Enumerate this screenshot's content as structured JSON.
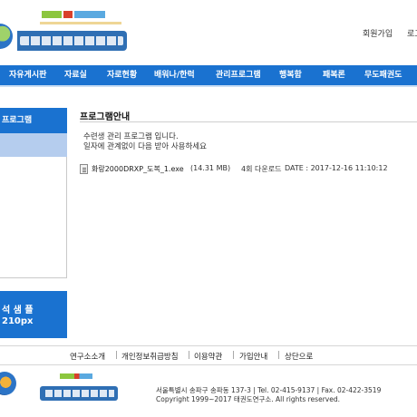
{
  "header": {
    "top_links": {
      "join": "회원가입",
      "login": "로그"
    },
    "colors": {
      "brand_blue": "#1a72d0",
      "highlight": "#b5cdee"
    }
  },
  "nav": {
    "items": [
      {
        "label": "자유게시판"
      },
      {
        "label": "자료실"
      },
      {
        "label": "자로현황"
      },
      {
        "label": "배워나/한럭"
      },
      {
        "label": "관리프로그램"
      },
      {
        "label": "행복함"
      },
      {
        "label": "패복론"
      },
      {
        "label": "무도패권도"
      }
    ]
  },
  "sidebar": {
    "title": "프로그램",
    "banner": {
      "line1": "석 샘 플",
      "line2": "210px"
    }
  },
  "content": {
    "title": "프로그램안내",
    "description": [
      "수련생 관리 프로그램 입니다.",
      "일자에 관계없이 다음 받아 사용하세요"
    ],
    "file": {
      "name": "화랑2000DRXP_도복_1.exe",
      "size": "(14.31 MB)",
      "downloads": "4회 다운로드",
      "date": "DATE : 2017-12-16 11:10:12"
    }
  },
  "footer": {
    "links": [
      {
        "label": "연구소소개"
      },
      {
        "label": "개인정보취급방침"
      },
      {
        "label": "이용약관"
      },
      {
        "label": "가입안내"
      },
      {
        "label": "상단으로"
      }
    ],
    "address": "서울특별시 송파구 송파동 137-3  |  Tel. 02-415-9137  |  Fax. 02-422-3519",
    "copyright": "Copyright 1999~2017 태권도연구소. All rights reserved."
  }
}
